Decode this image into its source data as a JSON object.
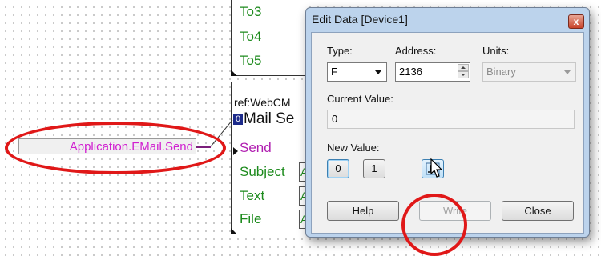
{
  "diagram": {
    "top_block": {
      "pins": [
        "To3",
        "To4",
        "To5"
      ]
    },
    "bottom_block": {
      "ref": "ref:WebCM",
      "badge": "0",
      "title": "Mail Se",
      "send_pin": "Send",
      "pins": [
        "Subject",
        "Text",
        "File"
      ],
      "pin_values": [
        "A",
        "A",
        "A"
      ]
    },
    "tag": "Application.EMail.Send"
  },
  "dialog": {
    "title": "Edit Data [Device1]",
    "close_glyph": "x",
    "type_label": "Type:",
    "type_value": "F",
    "address_label": "Address:",
    "address_value": "2136",
    "units_label": "Units:",
    "units_value": "Binary",
    "current_value_label": "Current Value:",
    "current_value": "0",
    "new_value_label": "New Value:",
    "btn_zero": "0",
    "btn_one": "1",
    "btn_help": "Help",
    "btn_write": "Write",
    "btn_close": "Close"
  },
  "colors": {
    "accent_pin": "#1c8a1c",
    "signal": "#d020d0",
    "annotation": "#e01818",
    "dialog_frame": "#bcd3ec"
  }
}
